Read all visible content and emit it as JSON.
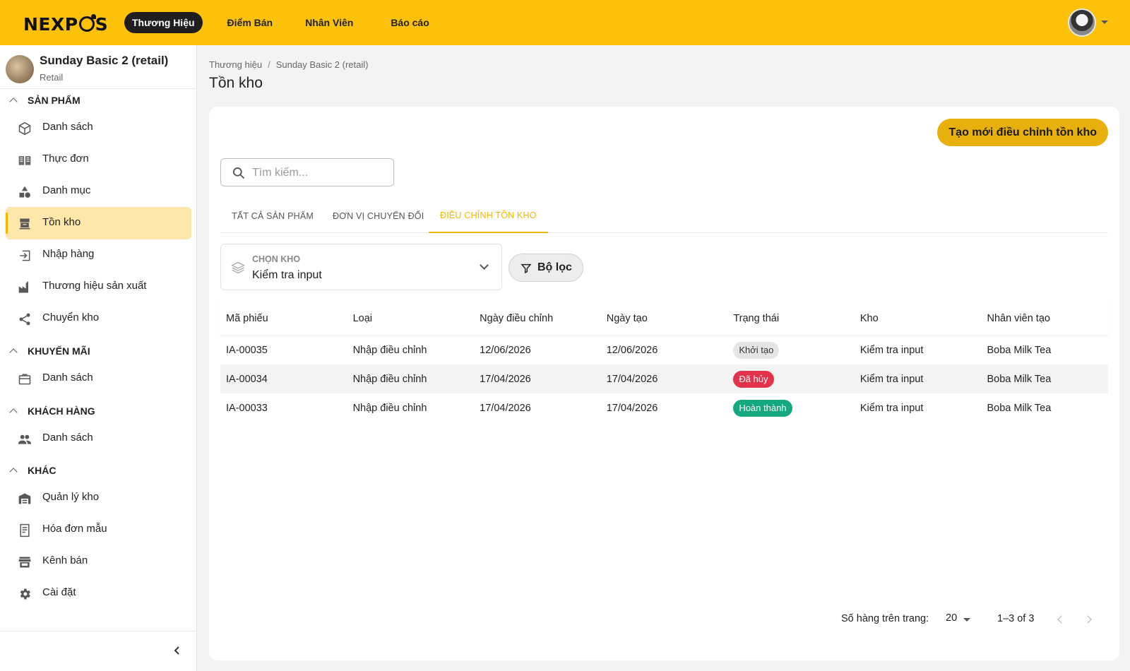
{
  "brand": {
    "name": "NEXPOS",
    "accent": "#fcc10b"
  },
  "top_nav": [
    {
      "label": "Thương Hiệu",
      "active": true
    },
    {
      "label": "Điểm Bán",
      "active": false
    },
    {
      "label": "Nhân Viên",
      "active": false
    },
    {
      "label": "Báo cáo",
      "active": false
    }
  ],
  "store": {
    "name": "Sunday Basic 2 (retail)",
    "type": "Retail"
  },
  "sidebar": {
    "sections": [
      {
        "title": "SẢN PHẨM"
      },
      {
        "title": "KHUYẾN MÃI"
      },
      {
        "title": "KHÁCH HÀNG"
      },
      {
        "title": "KHÁC"
      }
    ],
    "items": [
      {
        "label": "Danh sách",
        "icon": "cube-icon"
      },
      {
        "label": "Thực đơn",
        "icon": "menu-book-icon"
      },
      {
        "label": "Danh mục",
        "icon": "category-icon"
      },
      {
        "label": "Tồn kho",
        "icon": "inventory-icon",
        "active": true
      },
      {
        "label": "Nhập hàng",
        "icon": "import-icon"
      },
      {
        "label": "Thương hiệu sản xuất",
        "icon": "factory-icon"
      },
      {
        "label": "Chuyển kho",
        "icon": "share-icon"
      },
      {
        "label": "Danh sách",
        "icon": "voucher-icon"
      },
      {
        "label": "Danh sách",
        "icon": "people-icon"
      },
      {
        "label": "Quản lý kho",
        "icon": "warehouse-icon"
      },
      {
        "label": "Hóa đơn mẫu",
        "icon": "receipt-icon"
      },
      {
        "label": "Kênh bán",
        "icon": "storefront-icon"
      },
      {
        "label": "Cài đặt",
        "icon": "gear-icon"
      }
    ]
  },
  "breadcrumb": [
    "Thương hiệu",
    "Sunday Basic 2 (retail)"
  ],
  "page_title": "Tồn kho",
  "create_button": "Tạo mới điều chỉnh tồn kho",
  "search": {
    "placeholder": "Tìm kiếm..."
  },
  "tabs": [
    {
      "label": "TẤT CẢ SẢN PHẨM",
      "active": false
    },
    {
      "label": "ĐƠN VỊ CHUYỂN ĐỔI",
      "active": false
    },
    {
      "label": "ĐIỀU CHỈNH TỒN KHO",
      "active": true
    }
  ],
  "warehouse_select": {
    "label": "CHỌN KHO",
    "value": "Kiểm tra input"
  },
  "filter_button": "Bộ lọc",
  "table": {
    "columns": [
      "Mã phiếu",
      "Loại",
      "Ngày điều chỉnh",
      "Ngày tạo",
      "Trạng thái",
      "Kho",
      "Nhân viên tạo"
    ],
    "rows": [
      {
        "code": "IA-00035",
        "type": "Nhập điều chỉnh",
        "adjust_date": "12/06/2026",
        "created_date": "12/06/2026",
        "status": "Khởi tạo",
        "status_color": "#e5e5e5",
        "warehouse": "Kiểm tra input",
        "staff": "Boba Milk Tea"
      },
      {
        "code": "IA-00034",
        "type": "Nhập điều chỉnh",
        "adjust_date": "17/04/2026",
        "created_date": "17/04/2026",
        "status": "Đã hủy",
        "status_color": "#e3334a",
        "warehouse": "Kiểm tra input",
        "staff": "Boba Milk Tea"
      },
      {
        "code": "IA-00033",
        "type": "Nhập điều chỉnh",
        "adjust_date": "17/04/2026",
        "created_date": "17/04/2026",
        "status": "Hoàn thành",
        "status_color": "#15a77e",
        "warehouse": "Kiểm tra input",
        "staff": "Boba Milk Tea"
      }
    ]
  },
  "pagination": {
    "rows_per_page_label": "Số hàng trên trang:",
    "rows_per_page": "20",
    "range": "1–3 of 3"
  }
}
